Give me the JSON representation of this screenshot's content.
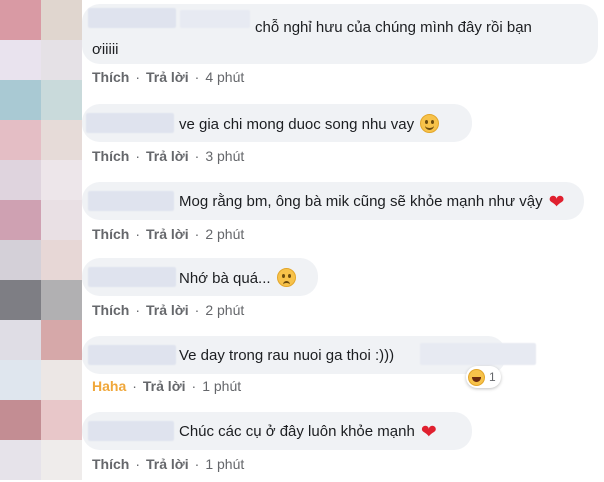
{
  "comments": [
    {
      "text_line1": "chỗ nghỉ hưu của chúng mình đây rồi bạn",
      "text_line2": "ơiiiii",
      "like_label": "Thích",
      "reply_label": "Trả lời",
      "time": "4 phút"
    },
    {
      "text": "ve gia chi mong duoc song nhu vay",
      "emoji": "slightly-smiling-face-icon",
      "like_label": "Thích",
      "reply_label": "Trả lời",
      "time": "3 phút"
    },
    {
      "text": "Mog rằng bm, ông bà mik cũng sẽ khỏe mạnh như vậy",
      "emoji": "heart-icon",
      "like_label": "Thích",
      "reply_label": "Trả lời",
      "time": "2 phút"
    },
    {
      "text": "Nhớ bà quá...",
      "emoji": "sad-face-icon",
      "like_label": "Thích",
      "reply_label": "Trả lời",
      "time": "2 phút"
    },
    {
      "text": "Ve day trong rau nuoi ga thoi :)))",
      "like_label": "Haha",
      "reply_label": "Trả lời",
      "time": "1 phút",
      "reaction": {
        "icon": "haha-icon",
        "count": "1"
      }
    },
    {
      "text": "Chúc các cụ ở đây luôn khỏe mạnh",
      "emoji": "heart-icon",
      "like_label": "Thích",
      "reply_label": "Trả lời",
      "time": "1 phút"
    }
  ],
  "colors": {
    "bubble": "#f0f2f5",
    "meta_text": "#65676b",
    "haha": "#f0a73a",
    "heart": "#e0202f"
  }
}
